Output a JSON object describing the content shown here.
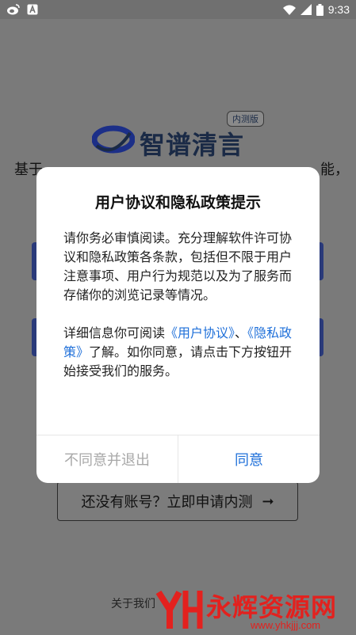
{
  "status_bar": {
    "time": "9:33",
    "left_icons": [
      "weibo-icon",
      "app-notification-icon"
    ],
    "right_icons": [
      "wifi-icon",
      "signal-icon",
      "battery-icon"
    ]
  },
  "app": {
    "logo_text": "智谱清言",
    "beta_badge": "内测版",
    "intro_visible_start": "基于",
    "intro_visible_end": "能，",
    "apply_button": "还没有账号？立即申请内测",
    "apply_arrow": "➞",
    "footer_visible": "关于我们"
  },
  "dialog": {
    "title": "用户协议和隐私政策提示",
    "para1": "请你务必审慎阅读。充分理解软件许可协议和隐私政策各条款，包括但不限于用户注意事项、用户行为规范以及为了服务而存储你的浏览记录等情况。",
    "para2_prefix": "详细信息你可阅读",
    "user_agreement_link": "《用户协议》",
    "para2_join": "、",
    "privacy_policy_link": "《隐私政策》",
    "para2_suffix": "了解。如你同意，请点击下方按钮开始接受我们的服务。",
    "decline_button": "不同意并退出",
    "agree_button": "同意"
  },
  "watermark": {
    "main": "永辉资源网",
    "url": "www.yhkjjj.com"
  },
  "colors": {
    "accent": "#1e6fd9",
    "watermark_red": "#e3211e",
    "scrim": "#7a7a7a"
  }
}
